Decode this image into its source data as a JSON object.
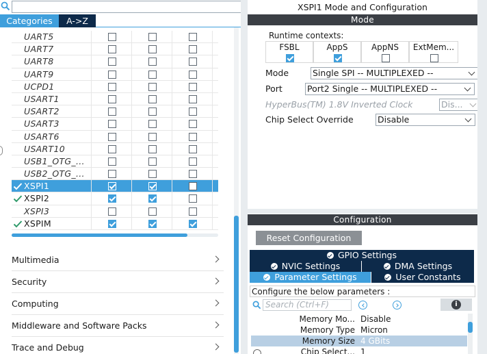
{
  "left": {
    "search": {
      "placeholder": ""
    },
    "tabs": [
      {
        "label": "Categories",
        "active": true
      },
      {
        "label": "A->Z",
        "active": false
      }
    ],
    "peripherals": [
      {
        "name": "UART5",
        "status": "",
        "c1": false,
        "c2": false,
        "c3": false
      },
      {
        "name": "UART7",
        "status": "",
        "c1": false,
        "c2": false,
        "c3": false
      },
      {
        "name": "UART8",
        "status": "",
        "c1": false,
        "c2": false,
        "c3": false
      },
      {
        "name": "UART9",
        "status": "",
        "c1": false,
        "c2": false,
        "c3": false
      },
      {
        "name": "UCPD1",
        "status": "",
        "c1": false,
        "c2": false,
        "c3": false
      },
      {
        "name": "USART1",
        "status": "",
        "c1": false,
        "c2": false,
        "c3": false
      },
      {
        "name": "USART2",
        "status": "",
        "c1": false,
        "c2": false,
        "c3": false
      },
      {
        "name": "USART3",
        "status": "",
        "c1": false,
        "c2": false,
        "c3": false
      },
      {
        "name": "USART6",
        "status": "",
        "c1": false,
        "c2": false,
        "c3": false
      },
      {
        "name": "USART10",
        "status": "",
        "c1": false,
        "c2": false,
        "c3": false
      },
      {
        "name": "USB1_OTG_...",
        "status": "",
        "c1": false,
        "c2": false,
        "c3": false
      },
      {
        "name": "USB2_OTG_...",
        "status": "",
        "c1": false,
        "c2": false,
        "c3": false
      },
      {
        "name": "XSPI1",
        "status": "ok",
        "selected": true,
        "c1": true,
        "c2": true,
        "c3": false
      },
      {
        "name": "XSPI2",
        "status": "ok",
        "c1": true,
        "c2": true,
        "c3": false
      },
      {
        "name": "XSPI3",
        "status": "",
        "c1": false,
        "c2": false,
        "c3": false
      },
      {
        "name": "XSPIM",
        "status": "ok",
        "c1": true,
        "c2": true,
        "c3": true
      }
    ],
    "hscroll_fraction": 0.85,
    "categories": [
      "Multimedia",
      "Security",
      "Computing",
      "Middleware and Software Packs",
      "Trace and Debug"
    ]
  },
  "right": {
    "title": "XSPI1 Mode and Configuration",
    "mode_header": "Mode",
    "runtime_label": "Runtime contexts:",
    "contexts": [
      {
        "label": "FSBL",
        "checked": true
      },
      {
        "label": "AppS",
        "checked": true
      },
      {
        "label": "AppNS",
        "checked": false
      },
      {
        "label": "ExtMem...",
        "checked": false
      }
    ],
    "mode_fields": [
      {
        "label": "Mode",
        "value": "Single SPI -- MULTIPLEXED --",
        "disabled": false
      },
      {
        "label": "Port",
        "value": "Port2 Single -- MULTIPLEXED --",
        "disabled": false
      },
      {
        "label": "HyperBus(TM) 1.8V Inverted Clock",
        "value": "Dis...",
        "disabled": true
      },
      {
        "label": "Chip Select Override",
        "value": "Disable",
        "disabled": false
      }
    ],
    "config_header": "Configuration",
    "reset_button": "Reset Configuration",
    "tabs": {
      "gpio": "GPIO Settings",
      "nvic": "NVIC Settings",
      "dma": "DMA Settings",
      "params": "Parameter Settings",
      "user": "User Constants"
    },
    "configure_label": "Configure the below parameters :",
    "param_search_placeholder": "Search (Ctrl+F)",
    "params": [
      {
        "key": "Memory Mo...",
        "value": "Disable"
      },
      {
        "key": "Memory Type",
        "value": "Micron"
      },
      {
        "key": "Memory Size",
        "value": "4 GBits",
        "selected": true
      },
      {
        "key": "Chip Select...",
        "value": "1"
      }
    ]
  }
}
